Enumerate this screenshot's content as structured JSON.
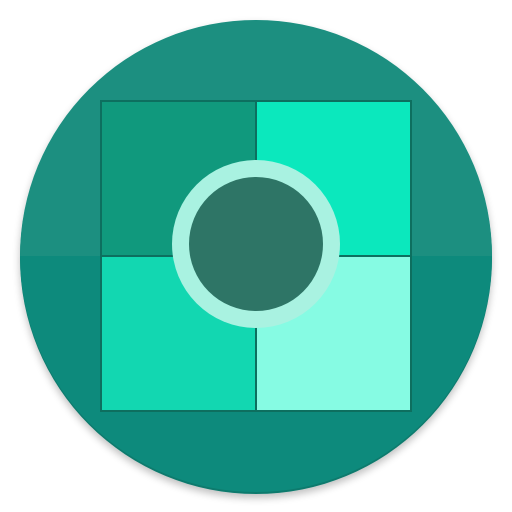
{
  "icon": {
    "name": "app-icon",
    "colors": {
      "disc_top": "#1a8f80",
      "disc_bottom": "#0e8a7b",
      "disc_edge": "#0b7a6d",
      "tile_top_left": "#10997d",
      "tile_top_right": "#0be8bd",
      "tile_bottom_left": "#12d7b1",
      "tile_bottom_right": "#86fbe3",
      "tile_outline": "#0d6f5f",
      "ring": "#a9f2e1",
      "center_dot": "#2e7566"
    }
  }
}
